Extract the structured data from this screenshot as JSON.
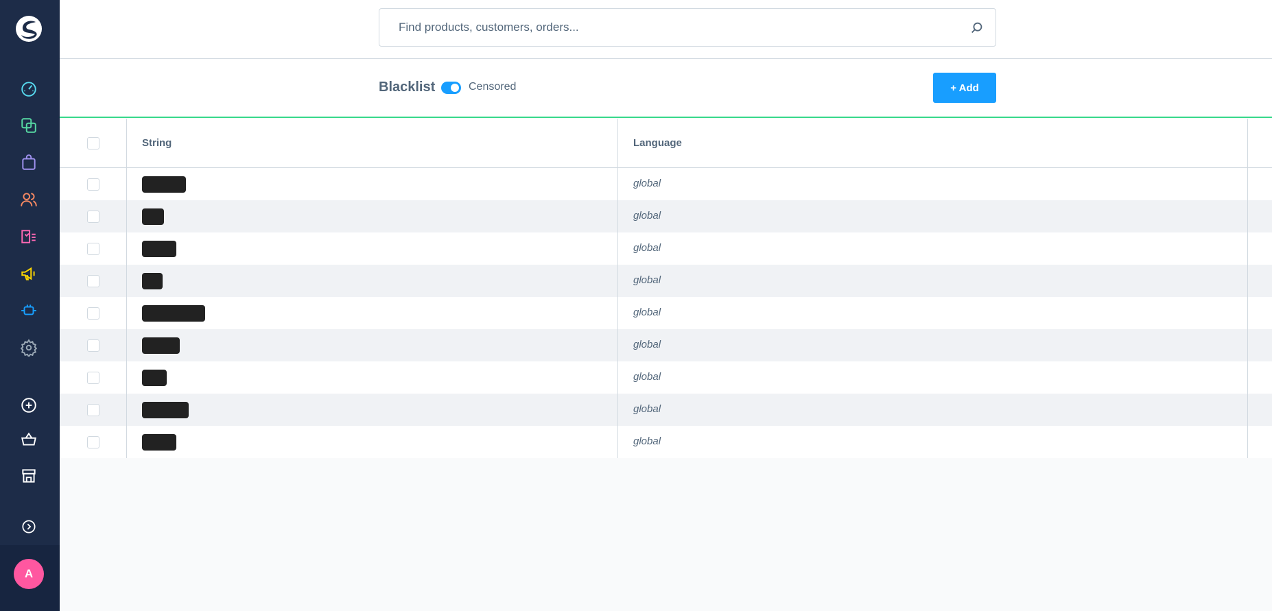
{
  "search": {
    "placeholder": "Find products, customers, orders..."
  },
  "toolbar": {
    "title": "Blacklist",
    "toggle_label": "Censored",
    "toggle_on": true,
    "add_label": "+ Add"
  },
  "table": {
    "columns": [
      "String",
      "Language"
    ],
    "rows": [
      {
        "string_redacted": true,
        "language": "global"
      },
      {
        "string_redacted": true,
        "language": "global"
      },
      {
        "string_redacted": true,
        "language": "global"
      },
      {
        "string_redacted": true,
        "language": "global"
      },
      {
        "string_redacted": true,
        "language": "global"
      },
      {
        "string_redacted": true,
        "language": "global"
      },
      {
        "string_redacted": true,
        "language": "global"
      },
      {
        "string_redacted": true,
        "language": "global"
      },
      {
        "string_redacted": true,
        "language": "global"
      }
    ]
  },
  "sidebar": {
    "nav": [
      {
        "icon": "dashboard-icon",
        "color": "#57d9ee"
      },
      {
        "icon": "catalogue-icon",
        "color": "#57d9a3"
      },
      {
        "icon": "orders-icon",
        "color": "#a092f0"
      },
      {
        "icon": "customers-icon",
        "color": "#f88962"
      },
      {
        "icon": "content-icon",
        "color": "#ff68b4"
      },
      {
        "icon": "marketing-icon",
        "color": "#ffd700"
      },
      {
        "icon": "extensions-icon",
        "color": "#189eff"
      },
      {
        "icon": "settings-icon",
        "color": "#9aa8b5"
      }
    ],
    "secondary": [
      "add-icon",
      "basket-icon",
      "store-icon",
      "collapse-icon"
    ],
    "avatar_initial": "A",
    "avatar_color": "#ff57a0"
  },
  "colors": {
    "accent": "#189eff",
    "sidebar": "#1d2c48",
    "divider": "#37d88a"
  }
}
